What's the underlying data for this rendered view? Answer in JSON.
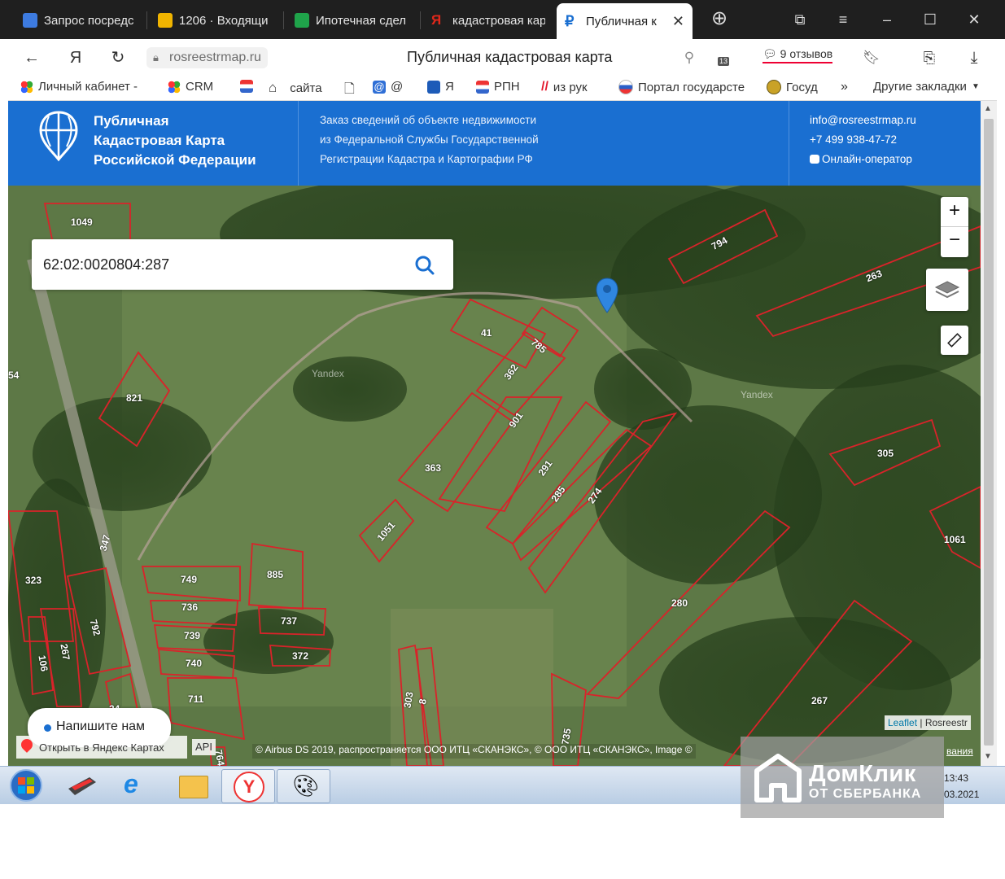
{
  "browser": {
    "tabs": [
      {
        "label": "Запрос посредс",
        "color": "#3d7be0"
      },
      {
        "label": "1206 · Входящи",
        "color": "#f0b400"
      },
      {
        "label": "Ипотечная сдел",
        "color": "#1fa34a"
      },
      {
        "label": "кадастровая кар",
        "color": "#e0271a"
      },
      {
        "label": "Публичная к",
        "color": "#1a6fd1",
        "active": true
      }
    ],
    "url": "rosreestrmap.ru",
    "page_title": "Публичная кадастровая карта",
    "reviews": "9 отзывов",
    "downloads_badge": "13",
    "bookmarks": [
      {
        "label": "Личный кабинет -",
        "icon": "colorful-dots-icon"
      },
      {
        "label": "CRM",
        "icon": "colorful-dots-icon"
      },
      {
        "label": "",
        "icon": "rosreestr-icon"
      },
      {
        "label": "сайта",
        "icon": "house-icon"
      },
      {
        "label": "",
        "icon": "page-icon"
      },
      {
        "label": "@",
        "icon": "at-icon"
      },
      {
        "label": "Я",
        "icon": "yandex-icon"
      },
      {
        "label": "РПН",
        "icon": "rosreestr-icon"
      },
      {
        "label": "из рук",
        "icon": "avito-icon"
      },
      {
        "label": "Портал государсте",
        "icon": "gosuslugi-icon"
      },
      {
        "label": "Госуд",
        "icon": "emblem-icon"
      }
    ],
    "more_bookmarks": "»",
    "other_bookmarks": "Другие закладки"
  },
  "site": {
    "logo_line1": "Публичная",
    "logo_line2": "Кадастровая Карта",
    "logo_line3": "Российской Федерации",
    "desc_line1": "Заказ сведений об объекте недвижимости",
    "desc_line2": "из Федеральной Службы Государственной",
    "desc_line3": "Регистрации Кадастра и Картографии РФ",
    "email": "info@rosreestrmap.ru",
    "phone": "+7 499 938-47-72",
    "operator": "Онлайн-оператор"
  },
  "map": {
    "search_value": "62:02:0020804:287",
    "zoom_in": "+",
    "zoom_out": "−",
    "chat_label": "Напишите нам",
    "open_yandex": "Открыть в Яндекс Картах",
    "api_label": "API",
    "attribution": "© Airbus DS 2019, распространяется ООО ИТЦ «СКАНЭКС», © ООО ИТЦ «СКАНЭКС», Image ©",
    "leaflet": "Leaflet",
    "attribution_right": "Rosreestr",
    "terms_fragment": "вания",
    "watermark": "Yandex",
    "parcel_labels": [
      "1049",
      "794",
      "263",
      "41",
      "785",
      "362",
      "54",
      "821",
      "901",
      "363",
      "291",
      "285",
      "274",
      "305",
      "1051",
      "1061",
      "347",
      "323",
      "749",
      "885",
      "736",
      "737",
      "739",
      "792",
      "267",
      "106",
      "372",
      "740",
      "711",
      "280",
      "303",
      "8",
      "735",
      "267",
      "764",
      "34"
    ]
  },
  "taskbar": {
    "time": "13:43",
    "date": "03.2021"
  },
  "watermark": {
    "brand": "ДомКлик",
    "sub": "ОТ СБЕРБАНКА"
  }
}
